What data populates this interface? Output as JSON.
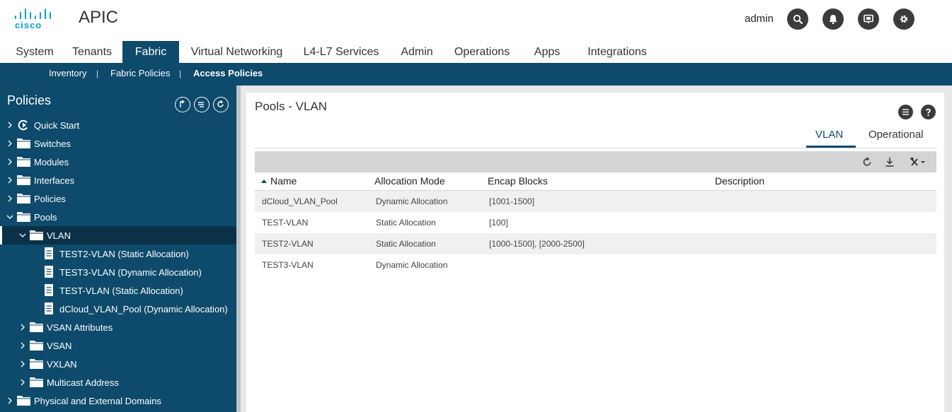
{
  "app": {
    "brand": "cisco",
    "title": "APIC",
    "user": "admin"
  },
  "header_icons": [
    "search-icon",
    "bell-icon",
    "presentation-icon",
    "gear-icon"
  ],
  "main_tabs": [
    {
      "label": "System"
    },
    {
      "label": "Tenants"
    },
    {
      "label": "Fabric",
      "active": true
    },
    {
      "label": "Virtual Networking"
    },
    {
      "label": "L4-L7 Services"
    },
    {
      "label": "Admin"
    },
    {
      "label": "Operations"
    },
    {
      "label": "Apps"
    },
    {
      "label": "Integrations"
    }
  ],
  "sub_nav": [
    {
      "label": "Inventory"
    },
    {
      "label": "Fabric Policies"
    },
    {
      "label": "Access Policies",
      "active": true
    }
  ],
  "sidebar": {
    "title": "Policies",
    "tree": [
      {
        "label": "Quick Start",
        "icon": "quick-start-icon",
        "level": 0,
        "expanded": false
      },
      {
        "label": "Switches",
        "icon": "folder-icon",
        "level": 0,
        "expanded": false
      },
      {
        "label": "Modules",
        "icon": "folder-icon",
        "level": 0,
        "expanded": false
      },
      {
        "label": "Interfaces",
        "icon": "folder-icon",
        "level": 0,
        "expanded": false
      },
      {
        "label": "Policies",
        "icon": "folder-icon",
        "level": 0,
        "expanded": false
      },
      {
        "label": "Pools",
        "icon": "folder-icon",
        "level": 0,
        "expanded": true
      },
      {
        "label": "VLAN",
        "icon": "folder-icon",
        "level": 1,
        "expanded": true,
        "selected": true
      },
      {
        "label": "TEST2-VLAN (Static Allocation)",
        "icon": "document-icon",
        "level": 2
      },
      {
        "label": "TEST3-VLAN (Dynamic Allocation)",
        "icon": "document-icon",
        "level": 2
      },
      {
        "label": "TEST-VLAN (Static Allocation)",
        "icon": "document-icon",
        "level": 2
      },
      {
        "label": "dCloud_VLAN_Pool (Dynamic Allocation)",
        "icon": "document-icon",
        "level": 2
      },
      {
        "label": "VSAN Attributes",
        "icon": "folder-icon",
        "level": 1,
        "expanded": false
      },
      {
        "label": "VSAN",
        "icon": "folder-icon",
        "level": 1,
        "expanded": false
      },
      {
        "label": "VXLAN",
        "icon": "folder-icon",
        "level": 1,
        "expanded": false
      },
      {
        "label": "Multicast Address",
        "icon": "folder-icon",
        "level": 1,
        "expanded": false
      },
      {
        "label": "Physical and External Domains",
        "icon": "folder-icon",
        "level": 0,
        "expanded": false
      }
    ]
  },
  "content": {
    "title": "Pools - VLAN",
    "tabs": [
      {
        "label": "VLAN",
        "active": true
      },
      {
        "label": "Operational"
      }
    ],
    "table": {
      "columns": [
        "Name",
        "Allocation Mode",
        "Encap Blocks",
        "Description"
      ],
      "sorted_by": "Name",
      "rows": [
        {
          "name": "dCloud_VLAN_Pool",
          "mode": "Dynamic Allocation",
          "blocks": "[1001-1500]",
          "description": ""
        },
        {
          "name": "TEST-VLAN",
          "mode": "Static Allocation",
          "blocks": "[100]",
          "description": ""
        },
        {
          "name": "TEST2-VLAN",
          "mode": "Static Allocation",
          "blocks": "[1000-1500], [2000-2500]",
          "description": ""
        },
        {
          "name": "TEST3-VLAN",
          "mode": "Dynamic Allocation",
          "blocks": "",
          "description": ""
        }
      ]
    }
  },
  "colors": {
    "nav_blue": "#0d4a6b",
    "cisco_blue": "#049fd9",
    "header_icon_bg": "#3b3b3b"
  }
}
